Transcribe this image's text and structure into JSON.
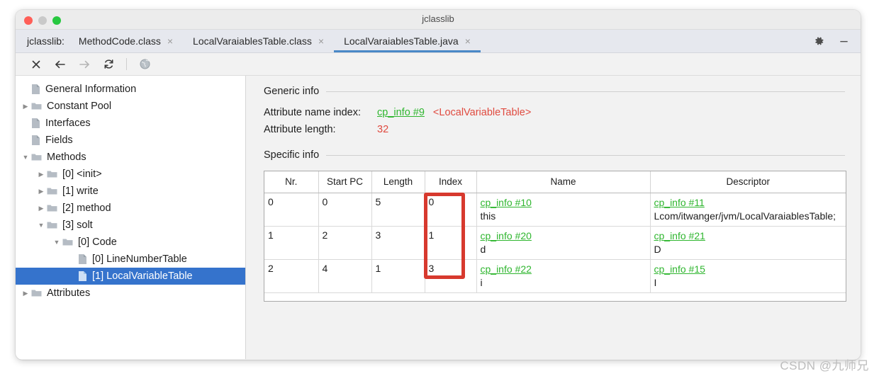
{
  "window": {
    "title": "jclasslib",
    "traffic_lights": [
      "close",
      "minimize",
      "maximize"
    ]
  },
  "tabbar": {
    "app_label": "jclasslib:",
    "tabs": [
      {
        "label": "MethodCode.class",
        "close": "×",
        "active": false
      },
      {
        "label": "LocalVaraiablesTable.class",
        "close": "×",
        "active": false
      },
      {
        "label": "LocalVaraiablesTable.java",
        "close": "×",
        "active": true
      }
    ],
    "right_icons": [
      {
        "name": "gear-icon",
        "glyph": "⚙"
      },
      {
        "name": "minimize-icon",
        "glyph": "—"
      }
    ]
  },
  "toolbar": {
    "buttons": [
      {
        "name": "close-icon",
        "glyph": "✕",
        "dim": false
      },
      {
        "name": "back-arrow-icon",
        "glyph": "←",
        "dim": false
      },
      {
        "name": "forward-arrow-icon",
        "glyph": "→",
        "dim": true
      },
      {
        "name": "reload-icon",
        "glyph": "↻",
        "dim": false
      },
      {
        "name": "browse-globe-icon",
        "glyph": "ἱ0",
        "dim": true
      }
    ]
  },
  "sidebar": {
    "items": [
      {
        "label": "General Information",
        "indent": 0,
        "twisty": "",
        "icon": "file",
        "selected": false
      },
      {
        "label": "Constant Pool",
        "indent": 0,
        "twisty": "▶",
        "icon": "folder",
        "selected": false
      },
      {
        "label": "Interfaces",
        "indent": 0,
        "twisty": "",
        "icon": "file",
        "selected": false
      },
      {
        "label": "Fields",
        "indent": 0,
        "twisty": "",
        "icon": "file",
        "selected": false
      },
      {
        "label": "Methods",
        "indent": 0,
        "twisty": "▼",
        "icon": "folder",
        "selected": false
      },
      {
        "label": "[0] <init>",
        "indent": 1,
        "twisty": "▶",
        "icon": "folder",
        "selected": false
      },
      {
        "label": "[1] write",
        "indent": 1,
        "twisty": "▶",
        "icon": "folder",
        "selected": false
      },
      {
        "label": "[2] method",
        "indent": 1,
        "twisty": "▶",
        "icon": "folder",
        "selected": false
      },
      {
        "label": "[3] solt",
        "indent": 1,
        "twisty": "▼",
        "icon": "folder",
        "selected": false
      },
      {
        "label": "[0] Code",
        "indent": 2,
        "twisty": "▼",
        "icon": "folder",
        "selected": false
      },
      {
        "label": "[0] LineNumberTable",
        "indent": 3,
        "twisty": "",
        "icon": "file",
        "selected": false
      },
      {
        "label": "[1] LocalVariableTable",
        "indent": 3,
        "twisty": "",
        "icon": "file",
        "selected": true
      },
      {
        "label": "Attributes",
        "indent": 0,
        "twisty": "▶",
        "icon": "folder",
        "selected": false
      }
    ]
  },
  "detail": {
    "generic_info": {
      "heading": "Generic info",
      "rows": [
        {
          "key": "Attribute name index:",
          "link": "cp_info #9",
          "annotation": "<LocalVariableTable>",
          "plain": ""
        },
        {
          "key": "Attribute length:",
          "link": "",
          "annotation": "",
          "plain": "32"
        }
      ]
    },
    "specific_info": {
      "heading": "Specific info",
      "table": {
        "columns": [
          "Nr.",
          "Start PC",
          "Length",
          "Index",
          "Name",
          "Descriptor"
        ],
        "rows": [
          {
            "nr": "0",
            "start_pc": "0",
            "length": "5",
            "index": "0",
            "name_link": "cp_info #10",
            "name_value": "this",
            "desc_link": "cp_info #11",
            "desc_value": "Lcom/itwanger/jvm/LocalVaraiablesTable;"
          },
          {
            "nr": "1",
            "start_pc": "2",
            "length": "3",
            "index": "1",
            "name_link": "cp_info #20",
            "name_value": "d",
            "desc_link": "cp_info #21",
            "desc_value": "D"
          },
          {
            "nr": "2",
            "start_pc": "4",
            "length": "1",
            "index": "3",
            "name_link": "cp_info #22",
            "name_value": "i",
            "desc_link": "cp_info #15",
            "desc_value": "I"
          }
        ]
      },
      "highlight": {
        "column": "Index",
        "color": "#d7392e"
      }
    }
  },
  "watermark": {
    "text": "CSDN @九师兄"
  },
  "colors": {
    "link_green": "#2fb62f",
    "value_red": "#e04a3f",
    "selection_blue": "#3573cc",
    "tab_underline": "#4a88c7",
    "highlight_red": "#d7392e"
  }
}
